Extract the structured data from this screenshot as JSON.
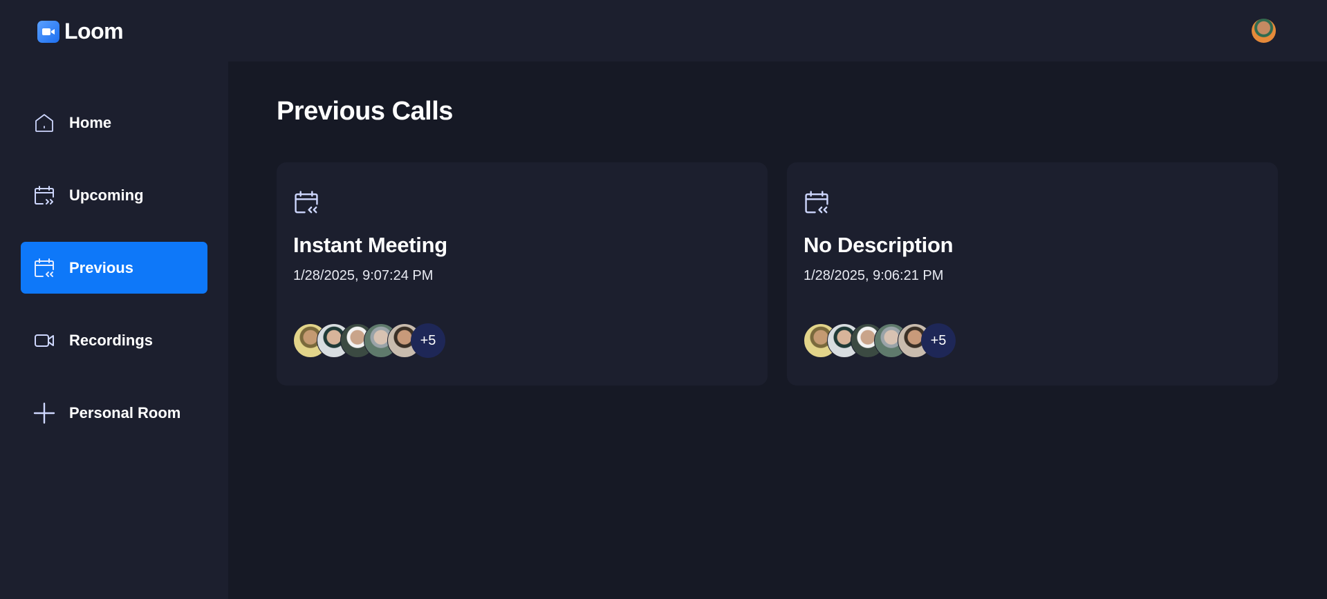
{
  "app": {
    "name": "Loom"
  },
  "header": {
    "avatar_icon": "user-avatar"
  },
  "sidebar": {
    "items": [
      {
        "label": "Home",
        "icon": "home-icon"
      },
      {
        "label": "Upcoming",
        "icon": "calendar-forward-icon"
      },
      {
        "label": "Previous",
        "icon": "calendar-back-icon",
        "active": true
      },
      {
        "label": "Recordings",
        "icon": "video-icon"
      },
      {
        "label": "Personal Room",
        "icon": "plus-icon"
      }
    ]
  },
  "main": {
    "title": "Previous Calls",
    "cards": [
      {
        "title": "Instant Meeting",
        "date": "1/28/2025, 9:07:24 PM",
        "more_attendees": "+5"
      },
      {
        "title": "No Description",
        "date": "1/28/2025, 9:06:21 PM",
        "more_attendees": "+5"
      }
    ]
  },
  "colors": {
    "background": "#161925",
    "panel": "#1c1f2e",
    "accent": "#0e78f9",
    "more_badge": "#1e2757"
  }
}
